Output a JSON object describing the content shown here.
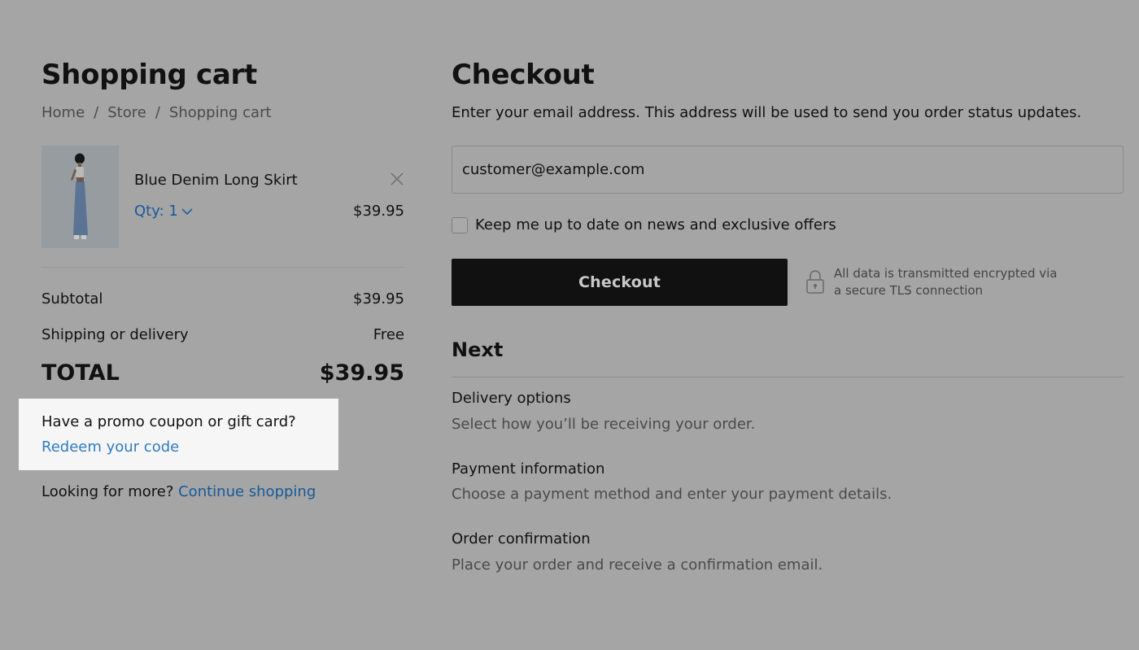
{
  "cart": {
    "title": "Shopping cart",
    "breadcrumb": [
      "Home",
      "Store",
      "Shopping cart"
    ],
    "breadcrumb_separator": "/",
    "item": {
      "name": "Blue Denim Long Skirt",
      "qty_label": "Qty: 1",
      "price": "$39.95",
      "remove_icon": "close-icon",
      "dropdown_icon": "chevron-down-icon"
    },
    "summary": {
      "subtotal_label": "Subtotal",
      "subtotal_value": "$39.95",
      "shipping_label": "Shipping or delivery",
      "shipping_value": "Free",
      "total_label": "TOTAL",
      "total_value": "$39.95"
    },
    "promo": {
      "question": "Have a promo coupon or gift card?",
      "link": "Redeem your code"
    },
    "more": {
      "text": "Looking for more?",
      "link": "Continue shopping"
    }
  },
  "checkout": {
    "title": "Checkout",
    "intro": "Enter your email address. This address will be used to send you order status updates.",
    "email_value": "customer@example.com",
    "newsletter_label": "Keep me up to date on news and exclusive offers",
    "newsletter_checked": false,
    "button_label": "Checkout",
    "secure_line1": "All data is transmitted encrypted via",
    "secure_line2": "a secure TLS connection",
    "secure_icon": "lock-icon",
    "next_title": "Next",
    "steps": [
      {
        "title": "Delivery options",
        "desc": "Select how you’ll be receiving your order."
      },
      {
        "title": "Payment information",
        "desc": "Choose a payment method and enter your payment details."
      },
      {
        "title": "Order confirmation",
        "desc": "Place your order and receive a confirmation email."
      }
    ]
  },
  "colors": {
    "overlay": "#a5a5a5",
    "link": "#17599a",
    "highlight_bg": "#f6f6f6",
    "button_bg": "#111111"
  }
}
